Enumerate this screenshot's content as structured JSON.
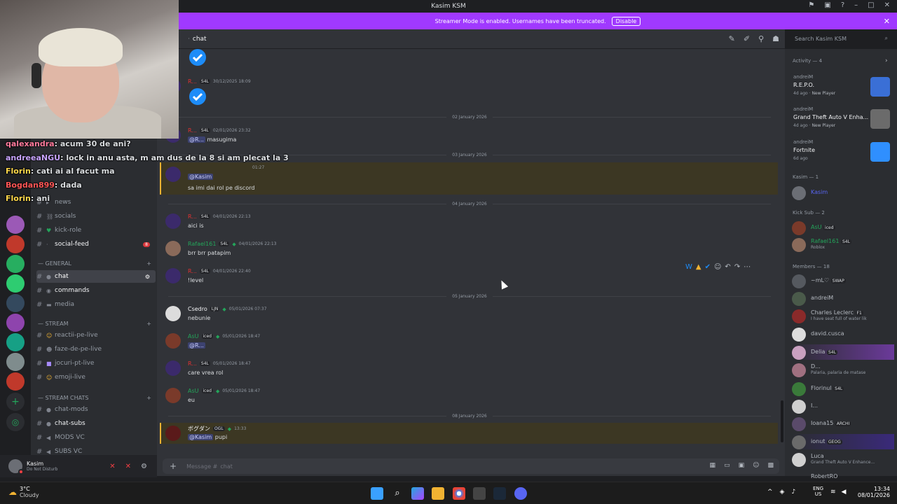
{
  "titlebar": {
    "title": "Kasim KSM"
  },
  "banner": {
    "text": "Streamer Mode is enabled. Usernames have been truncated.",
    "button": "Disable"
  },
  "overlay_chat": [
    {
      "user": "qalexandra",
      "text": "acum 30 de ani?",
      "color": "#ff7a9c"
    },
    {
      "user": "andreeaNGU",
      "text": "lock in anu asta, m am dus de la 8 si am plecat la 3",
      "color": "#c8a4ff"
    },
    {
      "user": "Florin",
      "text": "cati ai al facut ma",
      "color": "#ffd84a"
    },
    {
      "user": "Bogdan899",
      "text": "dada",
      "color": "#ff5555"
    },
    {
      "user": "Florin",
      "text": "ani",
      "color": "#ffd84a"
    }
  ],
  "sidebar": {
    "channels_top": [
      {
        "name": "news",
        "hash": "#"
      },
      {
        "name": "socials",
        "hash": "#"
      },
      {
        "name": "kick-role",
        "hash": "#"
      },
      {
        "name": "social-feed",
        "hash": "#",
        "mention": "8"
      }
    ],
    "category_general": "— GENERAL",
    "general": [
      {
        "name": "chat",
        "active": true
      },
      {
        "name": "commands"
      },
      {
        "name": "media"
      }
    ],
    "category_stream": "— STREAM",
    "stream": [
      {
        "name": "reactii-pe-live"
      },
      {
        "name": "faze-de-pe-live"
      },
      {
        "name": "jocuri-pt-live"
      },
      {
        "name": "emoji-live"
      }
    ],
    "category_streamchats": "— STREAM CHATS",
    "streamchats": [
      {
        "name": "chat-mods"
      },
      {
        "name": "chat-subs"
      },
      {
        "name": "MODS VC"
      },
      {
        "name": "SUBS VC"
      }
    ],
    "user": {
      "name": "Kasim",
      "status": "Do Not Disturb"
    }
  },
  "header": {
    "channel": "chat",
    "search_placeholder": "Search Kasim KSM"
  },
  "messages": {
    "m1": {
      "user": "R...",
      "tag": "S4L",
      "time": "30/12/2025 18:09"
    },
    "sep1": "02 January 2026",
    "m2": {
      "user": "R...",
      "tag": "S4L",
      "time": "02/01/2026 23:32",
      "mention": "@R...",
      "text": "masugima"
    },
    "sep2": "03 January 2026",
    "m3": {
      "time": "01:27",
      "mention": "@Kasim",
      "text": "sa imi dai rol pe discord"
    },
    "sep3": "04 January 2026",
    "m4": {
      "user": "R...",
      "tag": "S4L",
      "time": "04/01/2026 22:13",
      "text": "aici is"
    },
    "m5": {
      "user": "Rafael161",
      "tag": "S4L",
      "time": "04/01/2026 22:13",
      "text": "brr brr patapim"
    },
    "m6": {
      "user": "R...",
      "tag": "S4L",
      "time": "04/01/2026 22:40",
      "text": "!level"
    },
    "sep4": "05 January 2026",
    "m7": {
      "user": "Csedro",
      "tag": "LJN",
      "time": "05/01/2026 07:37",
      "text": "nebunie"
    },
    "m8": {
      "user": "AsU",
      "tag": "iced",
      "time": "05/01/2026 18:47",
      "mention": "@R..."
    },
    "m9": {
      "user": "R...",
      "tag": "S4L",
      "time": "05/01/2026 18:47",
      "text": "care vrea rol"
    },
    "m10": {
      "user": "AsU",
      "tag": "iced",
      "time": "05/01/2026 18:47",
      "text": "eu"
    },
    "sep5": "08 January 2026",
    "m11": {
      "user": "ボグダン",
      "tag": "OGL",
      "time": "13:33",
      "mention": "@Kasim",
      "text": "pupi"
    }
  },
  "composer": {
    "placeholder": "Message #",
    "channel": "chat"
  },
  "right": {
    "activity_title": "Activity — 4",
    "activities": [
      {
        "user": "andreiM",
        "game": "R.E.P.O.",
        "meta": "4d ago",
        "badge": "New Player",
        "color": "#3a6fd6"
      },
      {
        "user": "andreiM",
        "game": "Grand Theft Auto V Enha...",
        "meta": "4d ago",
        "badge": "New Player",
        "color": "#6b6b6b"
      },
      {
        "user": "andreiM",
        "game": "Fortnite",
        "meta": "6d ago",
        "badge": "",
        "color": "#2f8fff"
      }
    ],
    "kasim_title": "Kasim — 1",
    "kasim": {
      "name": "Kasim",
      "color": "#5865f2"
    },
    "kicksub_title": "Kick Sub — 2",
    "kicksub": [
      {
        "name": "AsU",
        "tag": "iced",
        "status": "",
        "color": "#23a55a"
      },
      {
        "name": "Rafael161",
        "tag": "S4L",
        "status": "Roblox",
        "color": "#23a55a"
      }
    ],
    "members_title": "Members — 18",
    "members": [
      {
        "name": "~mL♡",
        "tag": "SWAP",
        "status": "",
        "color": "#b5bac1"
      },
      {
        "name": "andreiM",
        "tag": "",
        "status": "",
        "color": "#b5bac1"
      },
      {
        "name": "Charles Leclerc",
        "tag": "F1",
        "status": "I have seat full of water lik",
        "color": "#b5bac1"
      },
      {
        "name": "david.cusca",
        "tag": "",
        "status": "",
        "color": "#b5bac1"
      },
      {
        "name": "Delia",
        "tag": "S4L",
        "status": "",
        "color": "#b5bac1"
      },
      {
        "name": "D...",
        "tag": "",
        "status": "Palaria, palaria de matase",
        "color": "#b5bac1"
      },
      {
        "name": "Florinul",
        "tag": "S4L",
        "status": "",
        "color": "#b5bac1"
      },
      {
        "name": "I...",
        "tag": "",
        "status": "",
        "color": "#b5bac1"
      },
      {
        "name": "Ioana15",
        "tag": "ARCHI",
        "status": "",
        "color": "#b5bac1"
      },
      {
        "name": "ionut",
        "tag": "GEOG",
        "status": "",
        "color": "#b5bac1"
      },
      {
        "name": "Luca",
        "tag": "",
        "status": "Grand Theft Auto V Enhance...",
        "color": "#b5bac1"
      },
      {
        "name": "RobertRO",
        "tag": "",
        "status": "",
        "color": "#b5bac1"
      }
    ]
  },
  "taskbar": {
    "weather_temp": "3°C",
    "weather_text": "Cloudy",
    "lang_top": "ENG",
    "lang_bottom": "US",
    "time": "13:34",
    "date": "08/01/2026"
  }
}
